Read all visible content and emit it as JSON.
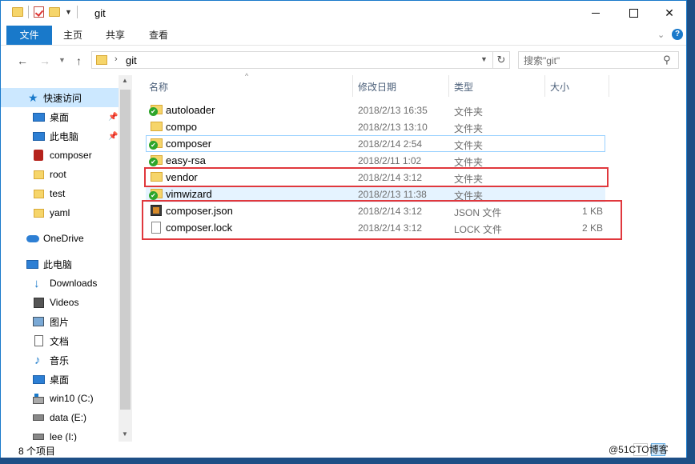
{
  "window": {
    "title": "git"
  },
  "ribbon": {
    "tabs": [
      "文件",
      "主页",
      "共享",
      "查看"
    ]
  },
  "address": {
    "path": "git",
    "search_placeholder": "搜索\"git\""
  },
  "nav": {
    "items": [
      {
        "label": "快速访问",
        "icon": "star-icon",
        "pinned": false
      },
      {
        "label": "桌面",
        "icon": "desktop-icon",
        "pinned": true
      },
      {
        "label": "此电脑",
        "icon": "computer-icon",
        "pinned": true
      },
      {
        "label": "composer",
        "icon": "composer-icon",
        "pinned": false
      },
      {
        "label": "root",
        "icon": "folder-icon",
        "pinned": false
      },
      {
        "label": "test",
        "icon": "folder-icon",
        "pinned": false
      },
      {
        "label": "yaml",
        "icon": "folder-icon",
        "pinned": false
      },
      {
        "label": "OneDrive",
        "icon": "cloud-icon",
        "pinned": false
      },
      {
        "label": "此电脑",
        "icon": "computer-icon",
        "pinned": false
      },
      {
        "label": "Downloads",
        "icon": "download-icon",
        "pinned": false
      },
      {
        "label": "Videos",
        "icon": "video-icon",
        "pinned": false
      },
      {
        "label": "图片",
        "icon": "picture-icon",
        "pinned": false
      },
      {
        "label": "文档",
        "icon": "document-icon",
        "pinned": false
      },
      {
        "label": "音乐",
        "icon": "music-icon",
        "pinned": false
      },
      {
        "label": "桌面",
        "icon": "desktop-icon",
        "pinned": false
      },
      {
        "label": "win10 (C:)",
        "icon": "windows-drive-icon",
        "pinned": false
      },
      {
        "label": "data (E:)",
        "icon": "drive-icon",
        "pinned": false
      },
      {
        "label": "lee (I:)",
        "icon": "drive-icon",
        "pinned": false
      }
    ]
  },
  "columns": {
    "name": "名称",
    "date": "修改日期",
    "type": "类型",
    "size": "大小"
  },
  "files": [
    {
      "name": "autoloader",
      "date": "2018/2/13 16:35",
      "type": "文件夹",
      "size": "",
      "icon": "folder-sync-icon"
    },
    {
      "name": "compo",
      "date": "2018/2/13 13:10",
      "type": "文件夹",
      "size": "",
      "icon": "folder-icon"
    },
    {
      "name": "composer",
      "date": "2018/2/14 2:54",
      "type": "文件夹",
      "size": "",
      "icon": "folder-sync-icon"
    },
    {
      "name": "easy-rsa",
      "date": "2018/2/11 1:02",
      "type": "文件夹",
      "size": "",
      "icon": "folder-sync-icon"
    },
    {
      "name": "vendor",
      "date": "2018/2/14 3:12",
      "type": "文件夹",
      "size": "",
      "icon": "folder-icon"
    },
    {
      "name": "vimwizard",
      "date": "2018/2/13 11:38",
      "type": "文件夹",
      "size": "",
      "icon": "folder-sync-icon"
    },
    {
      "name": "composer.json",
      "date": "2018/2/14 3:12",
      "type": "JSON 文件",
      "size": "1 KB",
      "icon": "json-file-icon"
    },
    {
      "name": "composer.lock",
      "date": "2018/2/14 3:12",
      "type": "LOCK 文件",
      "size": "2 KB",
      "icon": "file-icon"
    }
  ],
  "status": {
    "count": "8 个项目"
  },
  "watermark": "@51CTO博客",
  "colors": {
    "accent": "#1979ca",
    "selection": "#cce8ff",
    "highlight_box": "#e0383d"
  }
}
